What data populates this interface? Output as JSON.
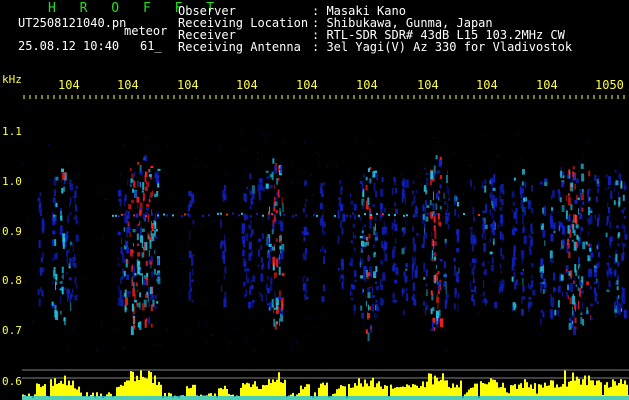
{
  "header": {
    "brand": "H R O F F T",
    "filename": "UT2508121040.pn",
    "tag": "meteor",
    "datetime": "25.08.12 10:40",
    "count": "61_"
  },
  "meta": [
    {
      "key": "Observer",
      "value": ": Masaki Kano"
    },
    {
      "key": "Receiving Location",
      "value": ": Shibukawa, Gunma, Japan"
    },
    {
      "key": "Receiver",
      "value": ": RTL-SDR SDR# 43dB L15 103.2MHz CW"
    },
    {
      "key": "Receiving Antenna",
      "value": ": 3el Yagi(V) Az 330 for Vladivostok"
    }
  ],
  "axis": {
    "y_unit": "kHz",
    "y_ticks": [
      "1.1",
      "1.0",
      "0.9",
      "0.8",
      "0.7",
      "0.6"
    ],
    "x_ticks": [
      "104",
      "104",
      "104",
      "104",
      "104",
      "104",
      "104",
      "104",
      "104",
      "1050"
    ]
  },
  "colors": {
    "text": "#ffffff",
    "brand": "#20e020",
    "axis_text": "#ffff40",
    "background": "#000000",
    "echo_low": "#1020c0",
    "echo_mid": "#20c0e0",
    "echo_high": "#ff2020",
    "echo_peak": "#ffff00",
    "baseline": "#808080"
  }
}
